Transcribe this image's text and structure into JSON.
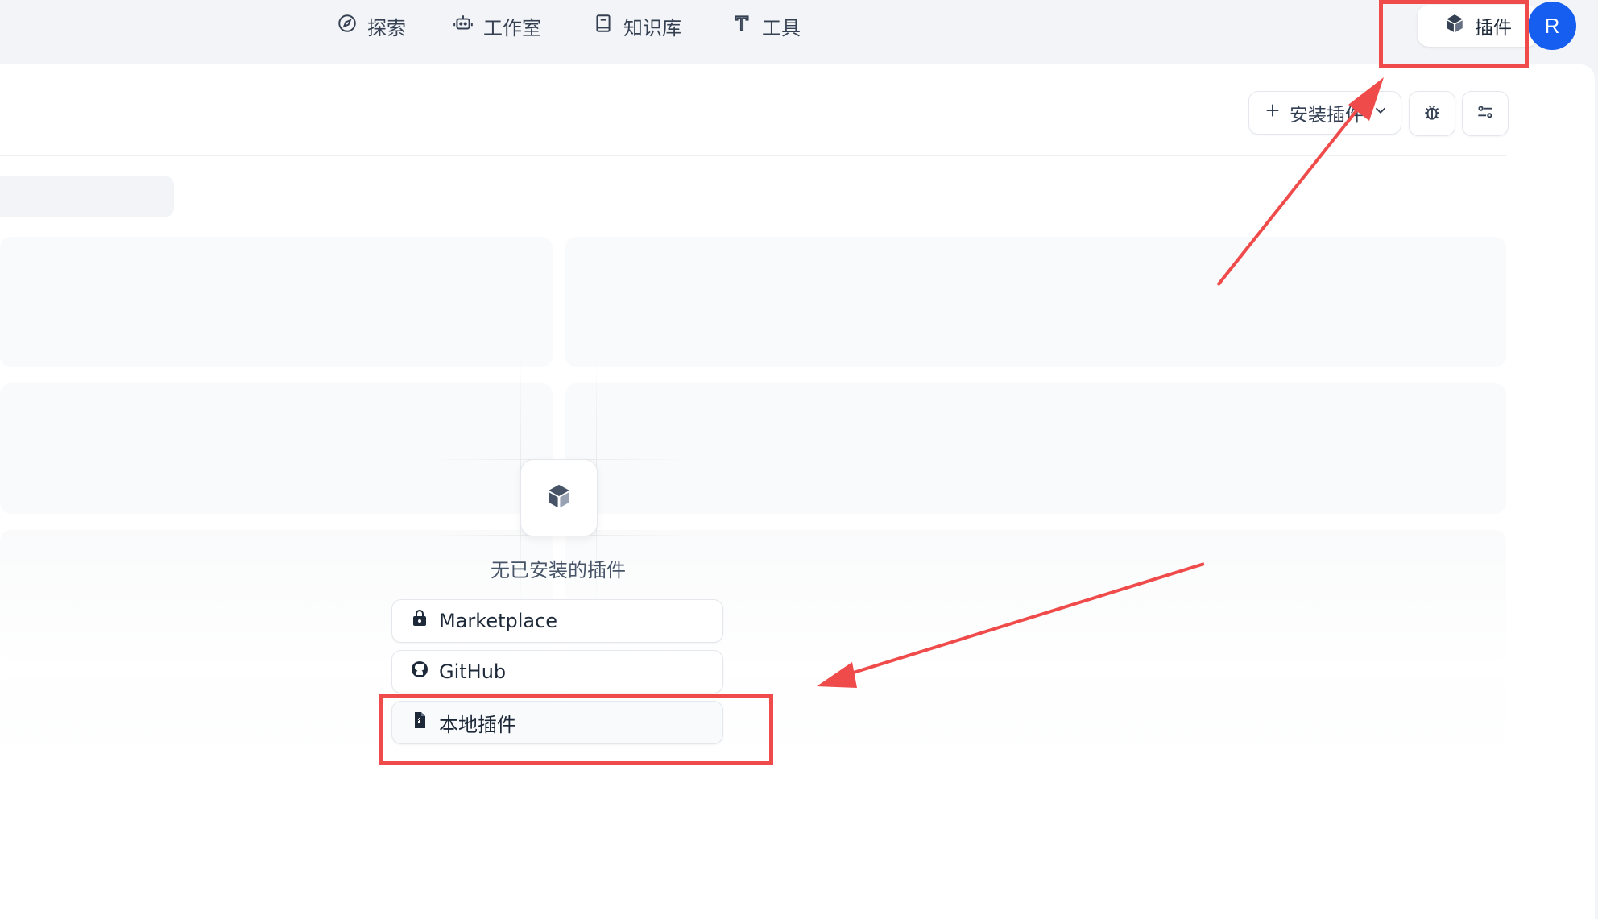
{
  "topnav": {
    "items": [
      {
        "label": "探索",
        "icon": "compass-icon"
      },
      {
        "label": "工作室",
        "icon": "robot-icon"
      },
      {
        "label": "知识库",
        "icon": "book-icon"
      },
      {
        "label": "工具",
        "icon": "tool-icon"
      }
    ],
    "plugins_label": "插件",
    "avatar_initial": "R"
  },
  "toolbar": {
    "install_label": "安装插件",
    "debug_icon": "bug-icon",
    "filter_icon": "sliders-icon"
  },
  "empty_state": {
    "icon": "cube-icon",
    "message": "无已安装的插件",
    "sources": [
      {
        "label": "Marketplace",
        "icon": "store-icon"
      },
      {
        "label": "GitHub",
        "icon": "github-icon"
      },
      {
        "label": "本地插件",
        "icon": "file-package-icon"
      }
    ]
  },
  "colors": {
    "accent": "#155eef",
    "annotation": "#f04b4b",
    "background": "#f2f4f7"
  }
}
